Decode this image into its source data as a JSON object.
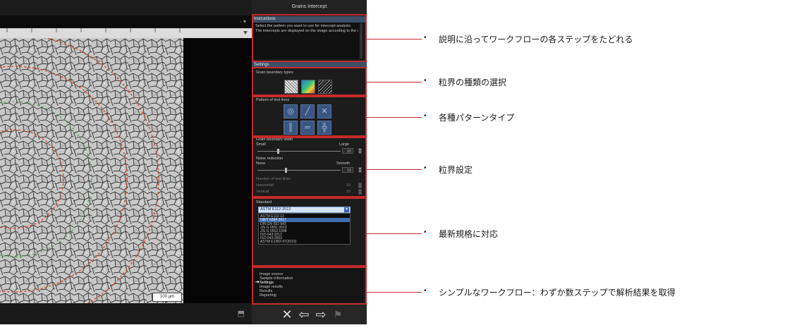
{
  "panel": {
    "title": "Grains Intercept",
    "instructions": {
      "header": "Instructions",
      "text_line1": "Select the pattern you want to use for intercept analysis.",
      "text_line2": "The intercepts are displayed on the image according to the selected settings."
    },
    "settings_header": "Settings",
    "grain_boundary_types_label": "Grain boundary types",
    "pattern_label": "Pattern of test lines",
    "grain_boundary_width": {
      "label": "Grain boundary width",
      "min_label": "Small",
      "max_label": "Large",
      "value": "10"
    },
    "noise_reduction": {
      "label": "Noise reduction",
      "min_label": "None",
      "max_label": "Smooth",
      "value": "11"
    },
    "number_of_test_lines": {
      "label": "Number of test lines",
      "horizontal_label": "Horizontal",
      "horizontal_value": "10",
      "vertical_label": "Vertical",
      "vertical_value": "10"
    },
    "standard": {
      "label": "Standard",
      "selected": "ASTM E112-2013",
      "options": [
        "ASTM E112-2013",
        "ASTM E112-13",
        "GB/T 6394-2017",
        "DIN EN ISO 643",
        "JIS G 0551:2013",
        "JIS G 0552:1998",
        "ISO 643:2012",
        "ISO 643:2003",
        "ASTM E1382-97(2015)"
      ],
      "highlighted_index": 2
    },
    "workflow_steps": [
      "Image source",
      "Sample information",
      "Settings",
      "Image results",
      "Results",
      "Reporting"
    ],
    "current_step_index": 2,
    "nav": {
      "close": "✕",
      "back": "⇦",
      "next": "⇨",
      "finish": "⚑"
    }
  },
  "viewer": {
    "scale_label": "100 µm",
    "zoom_controls": "◦ ▾"
  },
  "callouts": [
    "説明に沿ってワークフローの各ステップをたどれる",
    "粒界の種類の選択",
    "各種パターンタイプ",
    "粒界設定",
    "最新規格に対応",
    "シンプルなワークフロー：わずか数ステップで解析結果を取得"
  ],
  "colors": {
    "highlight_box": "#c62a2a",
    "section_header": "#3d4d66",
    "pattern_button": "#3a5580"
  }
}
